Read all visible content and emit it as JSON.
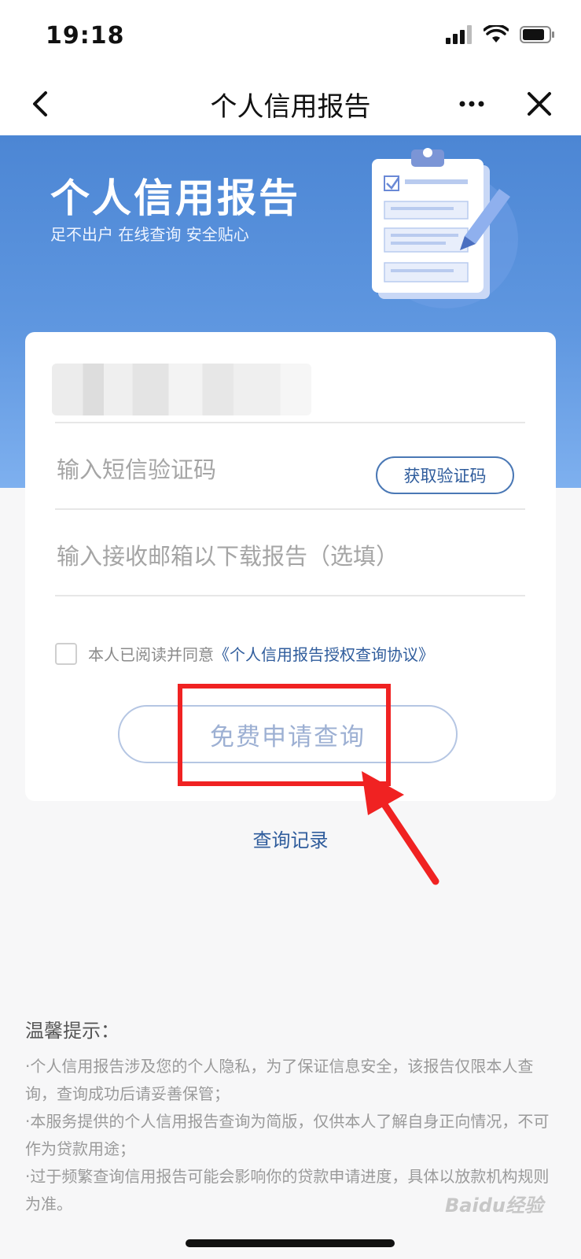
{
  "status_bar": {
    "time": "19:18"
  },
  "nav": {
    "title": "个人信用报告"
  },
  "hero": {
    "title": "个人信用报告",
    "subtitle": "足不出户 在线查询 安全贴心"
  },
  "form": {
    "sms_placeholder": "输入短信验证码",
    "get_code_label": "获取验证码",
    "email_placeholder": "输入接收邮箱以下载报告（选填）",
    "agree_text": "本人已阅读并同意",
    "agreement_link": "《个人信用报告授权查询协议》",
    "submit_label": "免费申请查询"
  },
  "history_link": "查询记录",
  "tips": {
    "title": "温馨提示：",
    "items": [
      "·个人信用报告涉及您的个人隐私，为了保证信息安全，该报告仅限本人查询，查询成功后请妥善保管；",
      "·本服务提供的个人信用报告查询为简版，仅供本人了解自身正向情况，不可作为贷款用途；",
      "·过于频繁查询信用报告可能会影响你的贷款申请进度，具体以放款机构规则为准。"
    ]
  },
  "watermark": "Baidu经验",
  "colors": {
    "hero_blue": "#4c86d4",
    "link_blue": "#2f5c9c",
    "highlight_red": "#f02222"
  },
  "icons": [
    "signal-icon",
    "wifi-icon",
    "battery-icon",
    "back-icon",
    "more-icon",
    "close-icon",
    "clipboard-illustration",
    "checkbox-icon",
    "arrow-annotation"
  ]
}
